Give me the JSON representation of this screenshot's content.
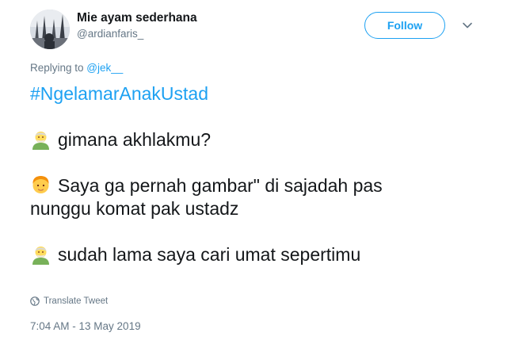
{
  "author": {
    "display_name": "Mie ayam sederhana",
    "handle": "@ardianfaris_"
  },
  "follow_label": "Follow",
  "reply": {
    "prefix": "Replying to ",
    "mention": "@jek__"
  },
  "tweet": {
    "hashtag": "#NgelamarAnakUstad",
    "lines": [
      {
        "emoji": "older-man-emoji",
        "text": "gimana akhlakmu?"
      },
      {
        "emoji": "person-emoji",
        "text": "Saya ga pernah gambar\" di sajadah pas"
      },
      {
        "emoji": "",
        "text": "nunggu komat pak ustadz"
      },
      {
        "emoji": "older-man-emoji",
        "text": "sudah lama saya cari umat sepertimu"
      }
    ]
  },
  "translate_label": "Translate Tweet",
  "timestamp": "7:04 AM - 13 May 2019",
  "colors": {
    "accent": "#1da1f2",
    "muted": "#657786",
    "text": "#14171a"
  }
}
